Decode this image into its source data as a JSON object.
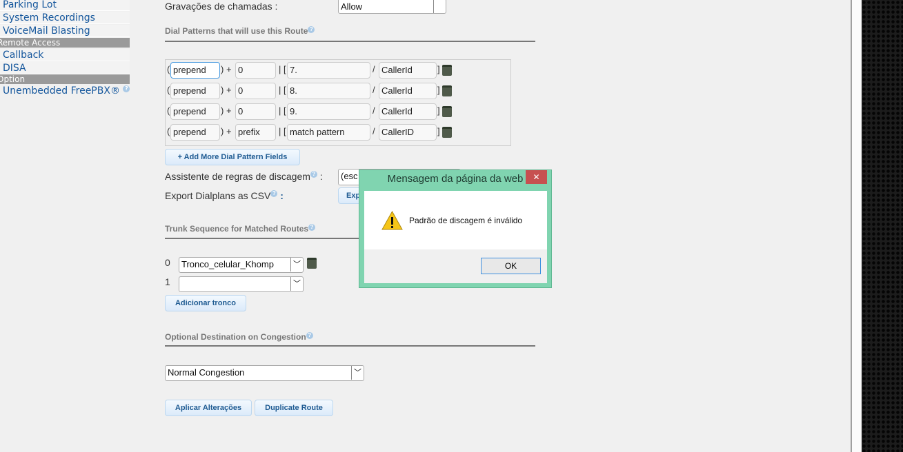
{
  "sidebar": {
    "items": [
      "Parking Lot",
      "System Recordings",
      "VoiceMail Blasting"
    ],
    "remote_access": {
      "header": "Remote Access",
      "items": [
        "Callback",
        "DISA"
      ]
    },
    "option": {
      "header": "Option",
      "items": [
        "Unembedded FreePBX®"
      ]
    }
  },
  "recording": {
    "label": "Gravações de chamadas",
    "value": "Allow"
  },
  "dial_patterns": {
    "title": "Dial Patterns that will use this Route",
    "rows": [
      {
        "prepend": "prepend",
        "prefix": "0",
        "match": "7.",
        "callerid": "CallerId"
      },
      {
        "prepend": "prepend",
        "prefix": "0",
        "match": "8.",
        "callerid": "CallerId"
      },
      {
        "prepend": "prepend",
        "prefix": "0",
        "match": "9.",
        "callerid": "CallerId"
      },
      {
        "prepend": "prepend",
        "prefix": "prefix",
        "match": "match pattern",
        "callerid": "CallerID"
      }
    ],
    "add_button": "+ Add More Dial Pattern Fields",
    "wizard_label": "Assistente de regras de discagem",
    "wizard_value": "(esc",
    "export_label": "Export Dialplans as CSV",
    "export_button": "Exp"
  },
  "trunks": {
    "title": "Trunk Sequence for Matched Routes",
    "rows": [
      {
        "index": "0",
        "value": "Tronco_celular_Khomp"
      },
      {
        "index": "1",
        "value": ""
      }
    ],
    "add_button": "Adicionar tronco"
  },
  "congestion": {
    "title": "Optional Destination on Congestion",
    "value": "Normal Congestion"
  },
  "actions": {
    "apply": "Aplicar Alterações",
    "duplicate": "Duplicate Route"
  },
  "dialog": {
    "title": "Mensagem da página da web",
    "message": "Padrão de discagem é inválido",
    "ok": "OK",
    "close": "✕"
  }
}
